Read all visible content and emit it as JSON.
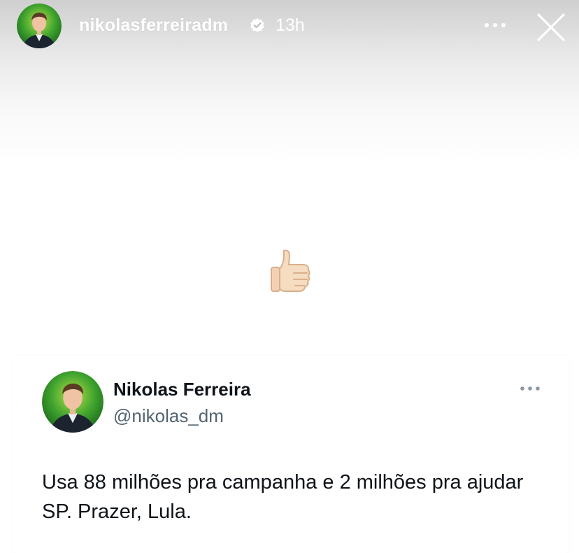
{
  "story": {
    "username": "nikolasferreiradm",
    "time": "13h",
    "verified": true,
    "icons": {
      "avatar": "avatar",
      "verified": "verified-badge-icon",
      "more": "more-dots-icon",
      "close": "close-icon",
      "sticker": "thumbs-up-icon"
    }
  },
  "tweet": {
    "display_name": "Nikolas Ferreira",
    "handle": "@nikolas_dm",
    "text": "Usa 88 milhões pra campanha e 2 milhões pra ajudar SP. Prazer, Lula.",
    "icons": {
      "more": "more-dots-icon"
    }
  },
  "colors": {
    "brand_green": "#2e9a2a",
    "text_primary": "#0f1419",
    "text_secondary": "#536471",
    "header_text": "#ffffff"
  }
}
